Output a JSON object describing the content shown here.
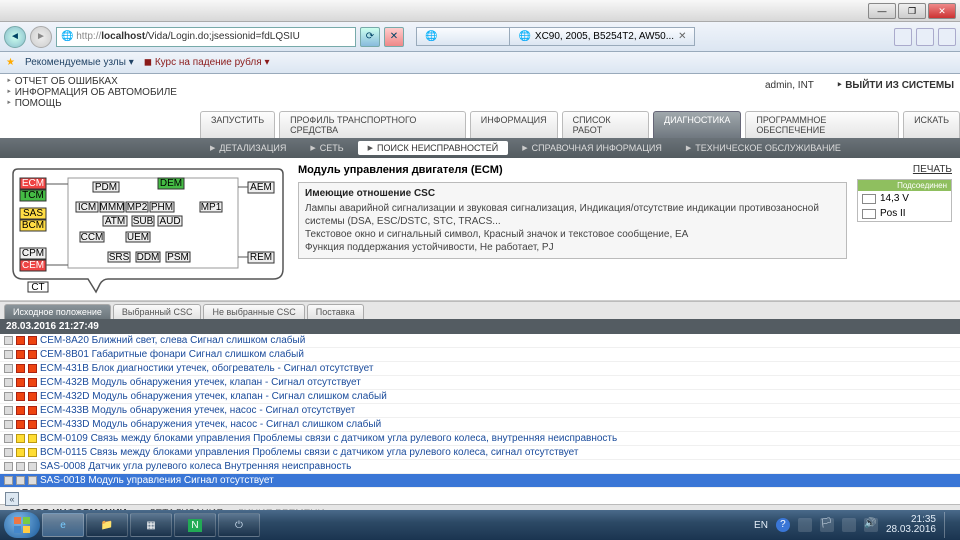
{
  "window": {
    "minimize": "—",
    "maximize": "❐",
    "close": "✕"
  },
  "browser": {
    "url_proto": "http://",
    "url_host": "localhost",
    "url_path": "/Vida/Login.do;jsessionid=fdLQSIU",
    "tab2": "XC90, 2005, B5254T2, AW50...",
    "fav_label": "Рекомендуемые узлы ▾",
    "fav_block": "Курс на падение рубля ▾"
  },
  "app": {
    "left_links": [
      "ОТЧЕТ ОБ ОШИБКАХ",
      "ИНФОРМАЦИЯ ОБ АВТОМОБИЛЕ",
      "ПОМОЩЬ"
    ],
    "login_user": "admin, INT",
    "logout": "ВЫЙТИ ИЗ СИСТЕМЫ",
    "main_tabs": [
      "ЗАПУСТИТЬ",
      "ПРОФИЛЬ ТРАНСПОРТНОГО СРЕДСТВА",
      "ИНФОРМАЦИЯ",
      "СПИСОК РАБОТ",
      "ДИАГНОСТИКА",
      "ПРОГРАММНОЕ ОБЕСПЕЧЕНИЕ",
      "ИСКАТЬ"
    ],
    "main_tab_active": 4,
    "sub_tabs": [
      "ДЕТАЛИЗАЦИЯ",
      "СЕТЬ",
      "ПОИСК НЕИСПРАВНОСТЕЙ",
      "СПРАВОЧНАЯ ИНФОРМАЦИЯ",
      "ТЕХНИЧЕСКОЕ ОБСЛУЖИВАНИЕ"
    ],
    "sub_tab_active": 2
  },
  "ecm": {
    "title": "Модуль управления двигателя (ECM)",
    "csc_hdr": "Имеющие отношение CSC",
    "csc_l1": "Лампы аварийной сигнализации и звуковая сигнализация, Индикация/отсутствие индикации противозаносной системы (DSA, ESC/DSTC, STC, TRACS...",
    "csc_l2": "Текстовое окно и сигнальный символ, Красный значок и текстовое сообщение, EA",
    "csc_l3": "Функция поддержания устойчивости, Не работает, PJ",
    "print": "ПЕЧАТЬ",
    "conn_hdr": "Подсоединен",
    "voltage": "14,3 V",
    "pos": "Pos II"
  },
  "diagram_boxes": [
    "ECM",
    "TCM",
    "SAS",
    "BCM",
    "CPM",
    "CEM",
    "CT",
    "PDM",
    "ICM",
    "MMM",
    "MP2",
    "PHM",
    "ATM",
    "SUB",
    "AUD",
    "CCM",
    "UEM",
    "SRS",
    "DDM",
    "PSM",
    "DEM",
    "MP1",
    "AEM",
    "REM"
  ],
  "lower": {
    "tabs": [
      "Исходное положение",
      "Выбранный CSC",
      "Не выбранные CSC",
      "Поставка"
    ],
    "active": 0,
    "timestamp": "28.03.2016 21:27:49"
  },
  "dtc": [
    {
      "lamps": "rr",
      "text": "CEM-8A20 Ближний свет, слева Сигнал слишком слабый"
    },
    {
      "lamps": "rr",
      "text": "CEM-8B01 Габаритные фонари Сигнал слишком слабый"
    },
    {
      "lamps": "rr",
      "text": "ECM-431B Блок диагностики утечек, обогреватель - Сигнал отсутствует"
    },
    {
      "lamps": "rr",
      "text": "ECM-432B Модуль обнаружения утечек, клапан - Сигнал отсутствует"
    },
    {
      "lamps": "rr",
      "text": "ECM-432D Модуль обнаружения утечек, клапан - Сигнал слишком слабый"
    },
    {
      "lamps": "rr",
      "text": "ECM-433B Модуль обнаружения утечек, насос - Сигнал отсутствует"
    },
    {
      "lamps": "rr",
      "text": "ECM-433D Модуль обнаружения утечек, насос - Сигнал слишком слабый"
    },
    {
      "lamps": "yy",
      "text": "BCM-0109 Связь между блоками управления Проблемы связи с датчиком угла рулевого колеса, внутренняя неисправность"
    },
    {
      "lamps": "yy",
      "text": "BCM-0115 Связь между блоками управления Проблемы связи с датчиком угла рулевого колеса, сигнал отсутствует"
    },
    {
      "lamps": "gg",
      "text": "SAS-0008 Датчик угла рулевого колеса Внутренняя неисправность"
    },
    {
      "lamps": "gg",
      "text": "SAS-0018 Модуль управления Сигнал отсутствует",
      "selected": true
    }
  ],
  "footer_tabs": {
    "t1": "ОБЗОР ИНФОРМАЦИИ",
    "t2": "ДЕТАЛИЗАЦИЯ",
    "t3": "ЛИНИЯ ВРЕМЕНИ"
  },
  "taskbar": {
    "lang": "EN",
    "time": "21:35",
    "date": "28.03.2016"
  }
}
